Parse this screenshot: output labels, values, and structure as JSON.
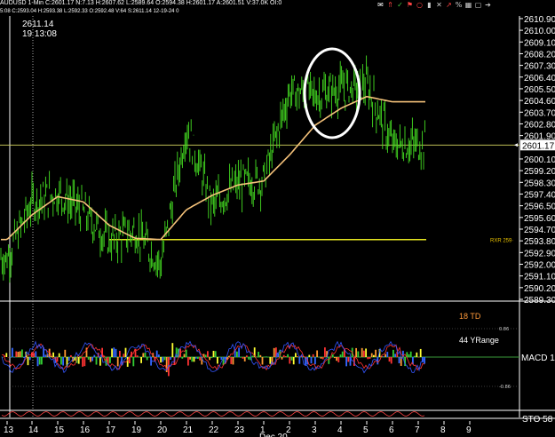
{
  "header": {
    "title_line": "AUDUSD 1-Min  C:2601.17 N:7.13 H:2607.62 L:2589.64 O:2594.38 H:2601.17 A:2601.51 V:37.0K OI:0",
    "sub_line": "5:08  C:2593.04 H:2593.38 L:2592.33 O:2592.48 V:64 S:2611.14 12-19-24  0"
  },
  "crosshair": {
    "price": "2611.14",
    "time": "19 13:08"
  },
  "toolbar_icons": [
    "envelope-icon",
    "up-arrow-icon",
    "check-icon",
    "flag-icon",
    "circle-icon",
    "bar-icon",
    "x-icon",
    "trend-icon",
    "percent-icon",
    "grid-icon",
    "box-icon",
    "arrow-icon"
  ],
  "colors": {
    "background": "#000000",
    "candles": "#44dd22",
    "ma": "#f5c27a",
    "support": "#e8e820",
    "price_label_bg": "#ffffff",
    "macd_line": "#3355ff",
    "signal_line": "#ff3333",
    "stoch": "#ff4444"
  },
  "chart_data": [
    {
      "type": "line",
      "title": "",
      "series": [
        {
          "name": "",
          "kind": "candlestick",
          "x": [
            13,
            14,
            15,
            16,
            17,
            19,
            20,
            21,
            22,
            23,
            1,
            2,
            3,
            4,
            5,
            6
          ],
          "values": [
            2592.5,
            2596.8,
            2597.5,
            2596.0,
            2593.8,
            2594.6,
            2592.0,
            2602.5,
            2596.5,
            2598.2,
            2598.5,
            2605.3,
            2605.0,
            2605.5,
            2605.8,
            2601.2
          ]
        },
        {
          "name": "",
          "kind": "moving-average",
          "x": [
            13,
            14,
            15,
            16,
            17,
            19,
            20,
            21,
            22,
            23,
            1,
            2,
            3,
            4,
            5,
            6
          ],
          "values": [
            2593.9,
            2595.8,
            2597.2,
            2596.8,
            2595.0,
            2594.0,
            2593.9,
            2596.2,
            2597.3,
            2598.1,
            2598.4,
            2600.4,
            2602.7,
            2604.0,
            2604.9,
            2604.5
          ]
        }
      ],
      "support_level": 2593.9,
      "support_label": "RXR 259·",
      "current_price": "2601.17",
      "yticks": [
        "2610.90",
        "2610.00",
        "2609.10",
        "2608.20",
        "2607.30",
        "2606.40",
        "2605.50",
        "2604.60",
        "2603.70",
        "2602.80",
        "2601.90",
        "2600.10",
        "2599.20",
        "2598.30",
        "2597.40",
        "2596.50",
        "2595.60",
        "2594.70",
        "2593.80",
        "2592.90",
        "2592.00",
        "2591.10",
        "2590.20",
        "2589.30"
      ],
      "ylim": [
        2589.3,
        2611.1
      ],
      "annotation": "circle around Dec 20 late-session high",
      "grid": false
    },
    {
      "type": "bar",
      "title": "MACD 1",
      "labels": {
        "td": "18 TD",
        "yrange": "44 YRange"
      },
      "levels": [
        "0.86",
        "-0.86"
      ],
      "series": [
        {
          "name": "",
          "values": []
        }
      ],
      "note": "histogram with MACD (blue) and signal (red) lines oscillating around zero"
    },
    {
      "type": "line",
      "title": "STO  58",
      "series": [
        {
          "name": "",
          "values": []
        }
      ]
    }
  ],
  "xaxis": {
    "ticks": [
      "13",
      "14",
      "15",
      "16",
      "17",
      "19",
      "20",
      "21",
      "22",
      "23",
      "1",
      "2",
      "3",
      "4",
      "5",
      "6",
      "7",
      "8",
      "9"
    ],
    "date_label": "Dec 20"
  }
}
